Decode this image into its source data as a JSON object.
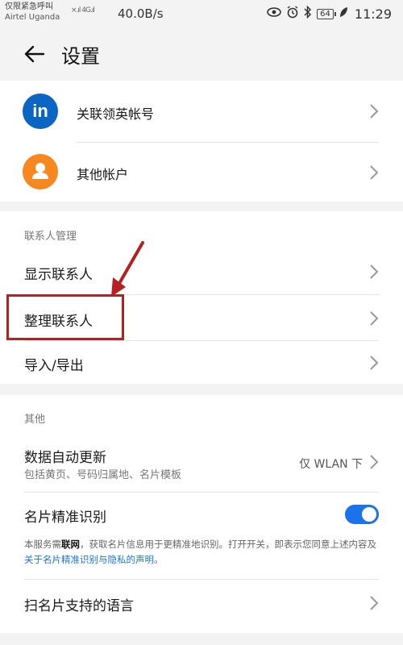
{
  "status_bar": {
    "carrier_line1": "仅限紧急呼叫",
    "carrier_line2": "Airtel Uganda",
    "signal": "×.ıl 4G.ıl",
    "speed": "40.0B/s",
    "battery": "64",
    "time": "11:29"
  },
  "header": {
    "title": "设置"
  },
  "accounts": {
    "linkedin_logo": "in",
    "linkedin_label": "关联领英帐号",
    "other_label": "其他帐户"
  },
  "contacts_section": {
    "header": "联系人管理",
    "items": [
      {
        "label": "显示联系人"
      },
      {
        "label": "整理联系人"
      },
      {
        "label": "导入/导出"
      }
    ]
  },
  "other_section": {
    "header": "其他",
    "auto_update": {
      "label": "数据自动更新",
      "subtext": "包括黄页、号码归属地、名片模板",
      "value": "仅 WLAN 下"
    },
    "card_recognition": {
      "label": "名片精准识别",
      "enabled": true,
      "notice_prefix": "本服务需",
      "notice_bold": "联网",
      "notice_middle": "，获取名片信息用于更精准地识别。打开开关，即表示您同意上述内容及",
      "notice_link": "关于名片精准识别与隐私的声明",
      "notice_suffix": "。"
    },
    "languages_label": "扫名片支持的语言"
  },
  "colors": {
    "accent": "#1a73e8",
    "linkedin": "#0a66c2",
    "avatar_orange": "#f7871f",
    "annotation_red": "#b52121"
  }
}
